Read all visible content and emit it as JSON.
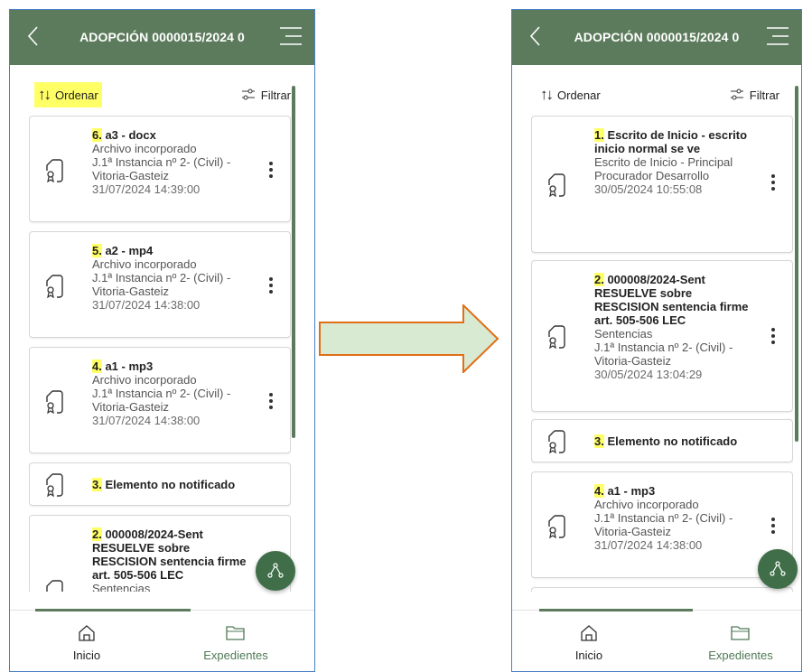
{
  "screens": [
    {
      "app_title": "ADOPCIÓN 0000015/2024 0",
      "sort_label": "Ordenar",
      "filter_label": "Filtrar",
      "items": [
        {
          "num": "6.",
          "title": " a3 - docx",
          "lines": [
            "Archivo incorporado",
            "J.1ª Instancia nº 2- (Civil) - Vitoria-Gasteiz"
          ],
          "date": "31/07/2024 14:39:00"
        },
        {
          "num": "5.",
          "title": " a2 - mp4",
          "lines": [
            "Archivo incorporado",
            "J.1ª Instancia nº 2- (Civil) - Vitoria-Gasteiz"
          ],
          "date": "31/07/2024 14:38:00"
        },
        {
          "num": "4.",
          "title": " a1 - mp3",
          "lines": [
            "Archivo incorporado",
            "J.1ª Instancia nº 2- (Civil) - Vitoria-Gasteiz"
          ],
          "date": "31/07/2024 14:38:00"
        },
        {
          "num": "3.",
          "title": " Elemento no notificado"
        },
        {
          "num": "2.",
          "title": " 000008/2024-Sent RESUELVE sobre RESCISION sentencia firme art. 505-506 LEC",
          "lines": [
            "Sentencias"
          ]
        }
      ],
      "nav": {
        "home": "Inicio",
        "files": "Expedientes"
      }
    },
    {
      "app_title": "ADOPCIÓN 0000015/2024 0",
      "sort_label": "Ordenar",
      "filter_label": "Filtrar",
      "items": [
        {
          "num": "1.",
          "title": " Escrito de Inicio - escrito inicio normal se ve",
          "lines": [
            "Escrito de Inicio - Principal",
            "Procurador Desarrollo"
          ],
          "date": "30/05/2024 10:55:08"
        },
        {
          "num": "2.",
          "title": " 000008/2024-Sent RESUELVE sobre RESCISION sentencia firme art. 505-506 LEC",
          "lines": [
            "Sentencias",
            "J.1ª Instancia nº 2- (Civil) - Vitoria-Gasteiz"
          ],
          "date": "30/05/2024 13:04:29"
        },
        {
          "num": "3.",
          "title": " Elemento no notificado"
        },
        {
          "num": "4.",
          "title": " a1 - mp3",
          "lines": [
            "Archivo incorporado",
            "J.1ª Instancia nº 2- (Civil) - Vitoria-Gasteiz"
          ],
          "date": "31/07/2024 14:38:00"
        }
      ],
      "nav": {
        "home": "Inicio",
        "files": "Expedientes"
      }
    }
  ],
  "colors": {
    "appbar": "#5c7b5c",
    "highlight": "#ffff66",
    "fab": "#3f6e48",
    "arrow_fill": "#d9ead3",
    "arrow_stroke": "#e06f17"
  }
}
